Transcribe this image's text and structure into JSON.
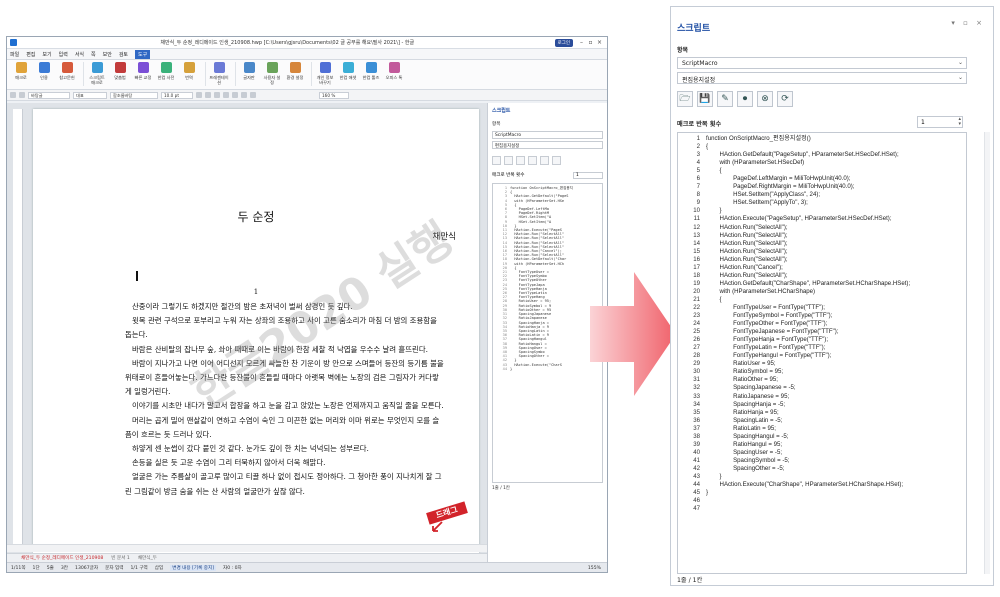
{
  "colors": {
    "accent": "#1f4ea3",
    "arrow": "#f0616a",
    "drag_label": "#d2232a",
    "menu_active": "#2f68c4"
  },
  "app": {
    "title": "채만식_두 순정_레디메이드 인생_210908.hwp [C:\\Users\\gjsru\\Documents\\02 글 공부를 해요\\필사 2021\\] - 한글",
    "login": "로그인",
    "menus": [
      "파일",
      "편집",
      "보기",
      "입력",
      "서식",
      "쪽",
      "보안",
      "검토",
      "도구"
    ],
    "ribbon": [
      {
        "label": "매크로",
        "icon": "macro-icon"
      },
      {
        "label": "인용",
        "icon": "quote-icon"
      },
      {
        "label": "참고문헌",
        "icon": "book-icon"
      },
      {
        "label": "스크립트 매크로",
        "icon": "script-icon"
      },
      {
        "label": "맞춤법",
        "icon": "spell-icon"
      },
      {
        "label": "빠른 교정",
        "icon": "quick-fix-icon"
      },
      {
        "label": "한컴 사전",
        "icon": "dictionary-icon"
      },
      {
        "label": "번역",
        "icon": "translate-icon"
      },
      {
        "label": "프레젠테이션",
        "icon": "presentation-icon"
      },
      {
        "label": "글자판",
        "icon": "keyboard-icon"
      },
      {
        "label": "사용자 설정",
        "icon": "user-icon"
      },
      {
        "label": "환경 설정",
        "icon": "settings-icon"
      },
      {
        "label": "개인 정보 바꾸기",
        "icon": "privacy-icon"
      },
      {
        "label": "한컴 애셋",
        "icon": "asset-icon"
      },
      {
        "label": "한컴 툴즈",
        "icon": "tools-icon"
      },
      {
        "label": "오피스 톡",
        "icon": "talk-icon"
      }
    ],
    "format": {
      "style": "바탕글",
      "lang": "대표",
      "font": "함초롬바탕",
      "size": "10.0 pt",
      "zoom": "160 %"
    },
    "document": {
      "title": "두 순정",
      "author": "채만식",
      "page_number": "1",
      "paragraphs": [
        "산중이라 그렇기도 하겠지만 절간의 밤은 초저녁이 벌써 삼경인 듯 깊다.",
        "윗목 관련 구석으로 포부리고 누워 자는 상좌의 조용하고 사이 고른 숨소리가 마침 더 밤의 조용함을 돕는다.",
        "바람은 산비탈의 잡나무 숲, 솨아 때때로 이는 바람이 한참 세찰 적 낙엽을 우수수 날려 흩뜨린다.",
        "바람이 지나가고 나면 이어 어디선지 모르게 싸늘한 찬 기운이 방 안으로 스며들어 등잔의 등기름 불을 위태로이 흔들어놓는다. 가느다란 등잔불이 흔들릴 때마다 아랫목 벽에는 노장의 검은 그림자가 커다랗게 일렁거린다.",
        "이야기를 시초만 내다가 말고서 합장을 하고 눈을 감고 앉았는 노장은 언제까지고 움직일 줄을 모른다.",
        "머리는 곱게 밀어 맨살같이 연하고 수염이 숙인 그 미끈한 없는 머리와 이마 위로는 무엇인지 모를 슬픔이 흐르는 듯 드러나 있다.",
        "하얗게 센 눈썹이 갔다 붙인 것 같다. 눈가도 깊이 한 치는 넉넉되는 성부르다.",
        "손등을 실은 듯 고운 수염이 그리 터북하지 않아서 더욱 해맑다.",
        "얼굴은 가는 주름살이 골고루 많이고 티끌 하나 없이 접시도 정아하다. 그 청아한 풍이 지나치게 잘 그린 그림같이 방금 숨을 쉬는 산 사람의 얼굴만가 싶잖 않다."
      ]
    },
    "tabs": [
      "채만식_두 순정_레디메이드 인생_210908",
      "빈 문서 1",
      "채만식_두"
    ],
    "status": [
      "1/11쪽",
      "1단",
      "5줄",
      "3칸",
      "13067글자",
      "문자 입력",
      "1/1 구역",
      "삽입",
      "변경 내용 [기록 중지]",
      "자0 : 0자"
    ],
    "status_zoom": "155%"
  },
  "small_panel": {
    "title": "스크립트",
    "items_label": "항목",
    "item1": "ScriptMacro",
    "item2": "편집용지설정",
    "repeat_label": "매크로 반복 횟수",
    "repeat_value": "1",
    "code_preview": [
      "function OnScriptMacro_편집용지",
      "{",
      "  HAction.GetDefault(\"PageS",
      "  with (HParameterSet.HSe",
      "  {",
      "    PageDef.LeftMa",
      "    PageDef.RightM",
      "    HSet.SetItem(\"A",
      "    HSet.SetItem(\"A",
      "  }",
      "  HAction.Execute(\"PageS",
      "  HAction.Run(\"SelectAll\"",
      "  HAction.Run(\"SelectAll\"",
      "  HAction.Run(\"SelectAll\"",
      "  HAction.Run(\"SelectAll\"",
      "  HAction.Run(\"Cancel\");",
      "  HAction.Run(\"SelectAll\"",
      "  HAction.GetDefault(\"Char",
      "  with (HParameterSet.HCh",
      "  {",
      "    FontTypeUser =",
      "    FontTypeSymbo",
      "    FontTypeOther",
      "    FontTypeJapa",
      "    FontTypeHanja",
      "    FontTypeLatin",
      "    FontTypeHang",
      "    RatioUser = 95;",
      "    RatioSymbol = 9",
      "    RatioOther = 95",
      "    SpacingJapanese",
      "    RatioJapanese",
      "    SpacingHanja =",
      "    RatioHanja = 9",
      "    SpacingLatin =",
      "    RatioLatin = 9",
      "    SpacingHangul",
      "    RatioHangul =",
      "    SpacingUser =",
      "    SpacingSymbo",
      "    SpacingOther =",
      "  }",
      "  HAction.Execute(\"CharS",
      "}"
    ],
    "footer": "1줄 / 1칸"
  },
  "watermark": "한글2020 실행",
  "drag_label": "드래그",
  "script_panel": {
    "title": "스크립트",
    "window_controls": "▾ ▫ ×",
    "items_label": "항목",
    "item1": "ScriptMacro",
    "item2": "편집용지설정",
    "toolbar": [
      {
        "name": "open-folder-icon",
        "glyph": "🗁"
      },
      {
        "name": "save-icon",
        "glyph": "💾"
      },
      {
        "name": "macro-edit-icon",
        "glyph": "✎"
      },
      {
        "name": "macro-record-icon",
        "glyph": "⏺"
      },
      {
        "name": "macro-delete-icon",
        "glyph": "⊗"
      },
      {
        "name": "macro-run-icon",
        "glyph": "⟳"
      }
    ],
    "repeat_label": "매크로 반복 횟수",
    "repeat_value": "1",
    "code": [
      "function OnScriptMacro_편집용지설정()",
      "{",
      "        HAction.GetDefault(\"PageSetup\", HParameterSet.HSecDef.HSet);",
      "        with (HParameterSet.HSecDef)",
      "        {",
      "                PageDef.LeftMargin = MiliToHwpUnit(40.0);",
      "                PageDef.RightMargin = MiliToHwpUnit(40.0);",
      "                HSet.SetItem(\"ApplyClass\", 24);",
      "                HSet.SetItem(\"ApplyTo\", 3);",
      "        }",
      "        HAction.Execute(\"PageSetup\", HParameterSet.HSecDef.HSet);",
      "        HAction.Run(\"SelectAll\");",
      "        HAction.Run(\"SelectAll\");",
      "        HAction.Run(\"SelectAll\");",
      "        HAction.Run(\"SelectAll\");",
      "        HAction.Run(\"SelectAll\");",
      "        HAction.Run(\"Cancel\");",
      "        HAction.Run(\"SelectAll\");",
      "        HAction.GetDefault(\"CharShape\", HParameterSet.HCharShape.HSet);",
      "        with (HParameterSet.HCharShape)",
      "        {",
      "                FontTypeUser = FontType(\"TTF\");",
      "                FontTypeSymbol = FontType(\"TTF\");",
      "                FontTypeOther = FontType(\"TTF\");",
      "                FontTypeJapanese = FontType(\"TTF\");",
      "                FontTypeHanja = FontType(\"TTF\");",
      "                FontTypeLatin = FontType(\"TTF\");",
      "                FontTypeHangul = FontType(\"TTF\");",
      "                RatioUser = 95;",
      "                RatioSymbol = 95;",
      "                RatioOther = 95;",
      "                SpacingJapanese = -5;",
      "                RatioJapanese = 95;",
      "                SpacingHanja = -5;",
      "                RatioHanja = 95;",
      "                SpacingLatin = -5;",
      "                RatioLatin = 95;",
      "                SpacingHangul = -5;",
      "                RatioHangul = 95;",
      "                SpacingUser = -5;",
      "                SpacingSymbol = -5;",
      "                SpacingOther = -5;",
      "        }",
      "        HAction.Execute(\"CharShape\", HParameterSet.HCharShape.HSet);",
      "}",
      "",
      ""
    ],
    "footer": "1줄 / 1칸"
  }
}
